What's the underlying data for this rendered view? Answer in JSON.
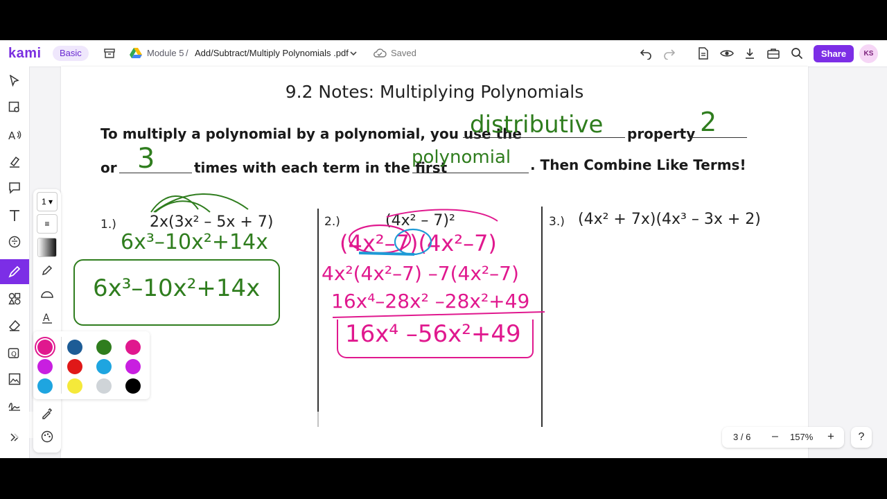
{
  "app": {
    "logo": "kami",
    "plan_badge": "Basic"
  },
  "breadcrumb": {
    "folder": "Module 5",
    "separator": "/",
    "file": "Add/Subtract/Multiply Polynomials .pdf"
  },
  "status": {
    "saved": "Saved"
  },
  "toolbar": {
    "share_label": "Share",
    "avatar_initials": "KS"
  },
  "pen_panel": {
    "size_value": "1"
  },
  "palette": {
    "colors": [
      "#e0188e",
      "#1d5c96",
      "#2f7d1e",
      "#e0188e",
      "#c81fe0",
      "#e01818",
      "#1ea5e0",
      "#c81fe0",
      "#1ea5e0",
      "#f5e93a",
      "#cfd4d8",
      "#000000"
    ],
    "selected_index": 0
  },
  "document": {
    "title": "9.2 Notes: Multiplying Polynomials",
    "line1_a": "To multiply a polynomial by a polynomial, you use the",
    "line1_b": "property",
    "line2_a": "or",
    "line2_b": "times with each term in the first",
    "line2_c": ". Then Combine Like Terms!",
    "handwriting": {
      "blank1": "distributive",
      "blank2": "2",
      "blank3": "3",
      "blank4": "polynomial"
    },
    "problems": [
      {
        "label": "1.)",
        "expr": "2x(3x² – 5x + 7)",
        "work": [
          "6x³–10x²+14x"
        ],
        "answer": "6x³–10x²+14x"
      },
      {
        "label": "2.)",
        "expr": "(4x² – 7)²",
        "work": [
          "(4x²–7)(4x²–7)",
          "4x²(4x²–7) –7(4x²–7)",
          "16x⁴–28x² –28x²+49"
        ],
        "answer": "16x⁴ –56x²+49"
      },
      {
        "label": "3.)",
        "expr": "(4x² + 7x)(4x³ – 3x + 2)"
      }
    ]
  },
  "pager": {
    "page_indicator": "3 / 6",
    "zoom": "157%",
    "minus": "–",
    "plus": "+",
    "help": "?"
  }
}
